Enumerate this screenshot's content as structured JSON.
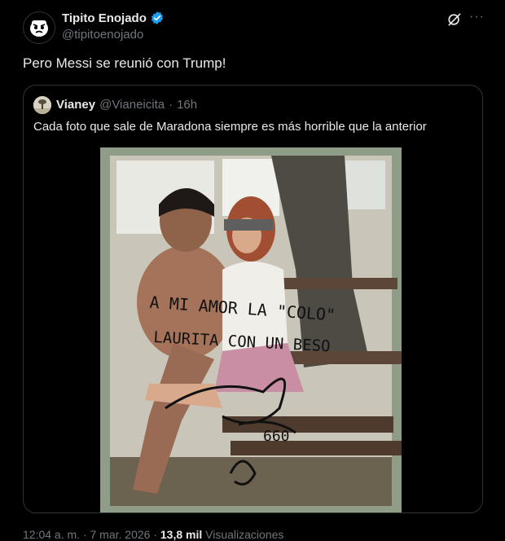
{
  "author": {
    "name": "Tipito Enojado",
    "handle": "@tipitoenojado",
    "verified": true
  },
  "tweet": {
    "text": "Pero Messi se reunió con Trump!"
  },
  "quoted": {
    "name": "Vianey",
    "handle": "@Vianeicita",
    "separator": "·",
    "time": "16h",
    "text": "Cada foto que sale de Maradona siempre es más horrible que la anterior",
    "photo_inscription": [
      "A MI AMOR LA \"COLO\"",
      "LAURITA CON UN BESO"
    ]
  },
  "footer": {
    "time": "12:04 a. m.",
    "separator1": "·",
    "date": "7 mar. 2026",
    "separator2": "·",
    "views_count": "13,8 mil",
    "views_label": "Visualizaciones"
  },
  "icons": {
    "more": "more-icon",
    "grok": "grok-icon",
    "verified": "verified-badge-icon"
  },
  "colors": {
    "background": "#000000",
    "text": "#e7e9ea",
    "secondary": "#71767b",
    "border": "#2f3336",
    "verified": "#1d9bf0"
  }
}
